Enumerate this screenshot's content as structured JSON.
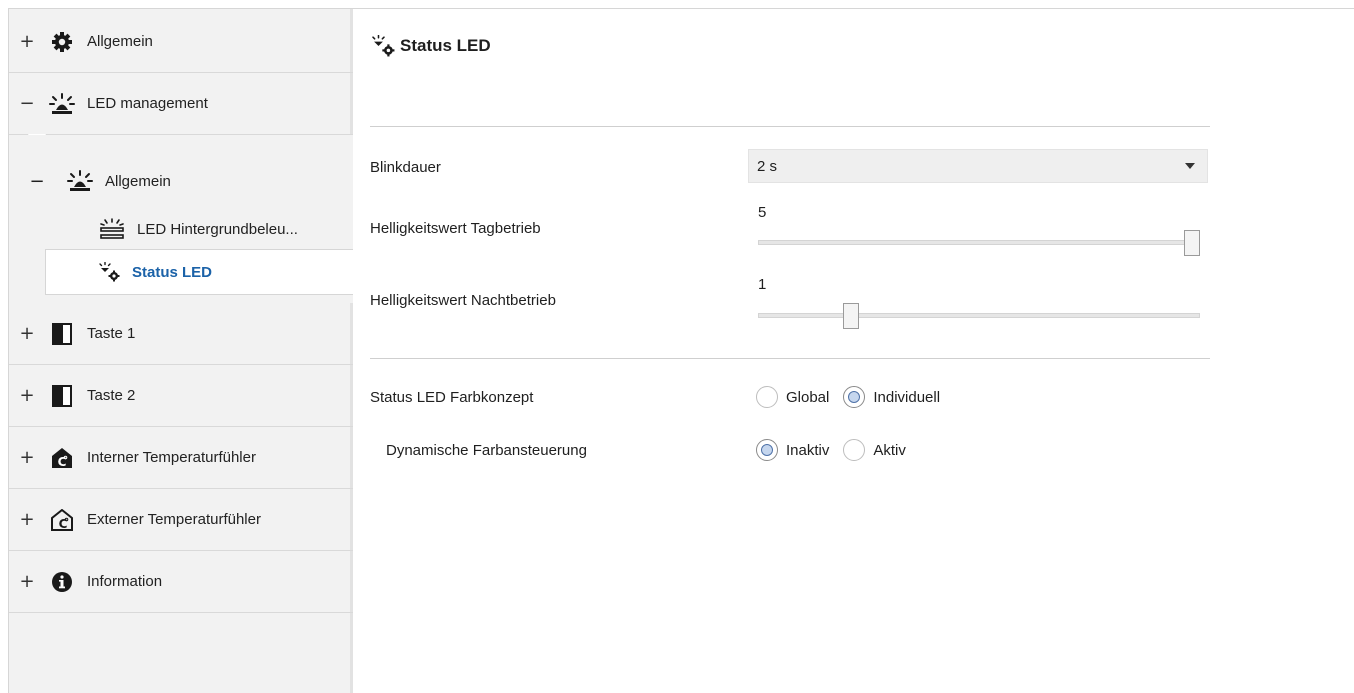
{
  "sidebar": {
    "items": [
      {
        "toggle": "+",
        "icon": "gear-icon",
        "label": "Allgemein"
      },
      {
        "toggle": "−",
        "icon": "led-light-icon",
        "label": "LED management"
      },
      {
        "toggle": "+",
        "icon": "button-half-icon",
        "label": "Taste 1"
      },
      {
        "toggle": "+",
        "icon": "button-half-icon",
        "label": "Taste 2"
      },
      {
        "toggle": "+",
        "icon": "internal-temperature-icon",
        "label": "Interner Temperaturfühler"
      },
      {
        "toggle": "+",
        "icon": "external-temperature-icon",
        "label": "Externer Temperaturfühler"
      },
      {
        "toggle": "+",
        "icon": "info-icon",
        "label": "Information"
      }
    ],
    "sub": {
      "group": {
        "toggle": "−",
        "icon": "led-light-icon",
        "label": "Allgemein"
      },
      "backlight": {
        "icon": "led-backlight-icon",
        "label": "LED Hintergrundbeleu..."
      },
      "active": {
        "icon": "status-led-icon",
        "label": "Status LED"
      }
    }
  },
  "main": {
    "title": "Status LED",
    "title_icon": "status-led-icon",
    "blinkdauer": {
      "label": "Blinkdauer",
      "value": "2 s"
    },
    "tag": {
      "label": "Helligkeitswert Tagbetrieb",
      "value": "5",
      "min": 0,
      "max": 5,
      "position": 5
    },
    "nacht": {
      "label": "Helligkeitswert Nachtbetrieb",
      "value": "1",
      "min": 0,
      "max": 5,
      "position": 1
    },
    "farbkonzept": {
      "label": "Status LED Farbkonzept",
      "options": [
        "Global",
        "Individuell"
      ],
      "selected": "Individuell"
    },
    "dynamisch": {
      "label": "Dynamische Farbansteuerung",
      "options": [
        "Inaktiv",
        "Aktiv"
      ],
      "selected": "Inaktiv"
    }
  }
}
